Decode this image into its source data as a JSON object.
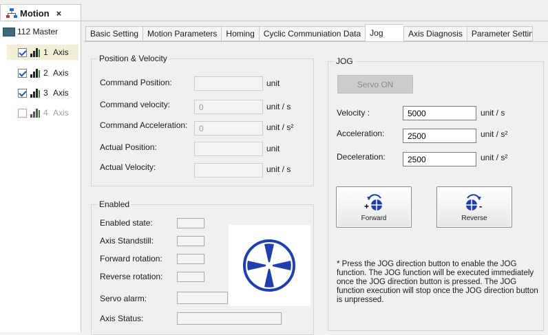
{
  "window": {
    "title": "Motion",
    "close": "×"
  },
  "tree": {
    "master": "112 Master",
    "axes": [
      {
        "num": "1",
        "label": "Axis",
        "checked": true
      },
      {
        "num": "2",
        "label": "Axis",
        "checked": true
      },
      {
        "num": "3",
        "label": "Axis",
        "checked": true
      },
      {
        "num": "4",
        "label": "Axis",
        "checked": false
      }
    ]
  },
  "tabs": [
    "Basic Setting",
    "Motion Parameters",
    "Homing",
    "Cyclic Communiation Data",
    "Jog",
    "Axis Diagnosis",
    "Parameter Settin"
  ],
  "active_tab": "Jog",
  "position_velocity": {
    "legend": "Position & Velocity",
    "rows": [
      {
        "label": "Command Position:",
        "value": "",
        "unit": "unit"
      },
      {
        "label": "Command velocity:",
        "value": "0",
        "unit": "unit / s"
      },
      {
        "label": "Command Acceleration:",
        "value": "0",
        "unit": "unit / s²"
      },
      {
        "label": "Actual Position:",
        "value": "",
        "unit": "unit"
      },
      {
        "label": "Actual Velocity:",
        "value": "",
        "unit": "unit / s"
      }
    ]
  },
  "enabled": {
    "legend": "Enabled",
    "rows": [
      {
        "label": "Enabled state:"
      },
      {
        "label": "Axis Standstill:"
      },
      {
        "label": "Forward rotation:"
      },
      {
        "label": "Reverse rotation:"
      },
      {
        "label": "Servo alarm:"
      },
      {
        "label": "Axis Status:"
      }
    ]
  },
  "jog": {
    "legend": "JOG",
    "servo_button": "Servo ON",
    "velocity": {
      "label": "Velocity :",
      "value": "5000",
      "unit": "unit / s"
    },
    "acceleration": {
      "label": "Acceleration:",
      "value": "2500",
      "unit": "unit / s²"
    },
    "deceleration": {
      "label": "Deceleration:",
      "value": "2500",
      "unit": "unit / s²"
    },
    "forward_label": "Forward",
    "reverse_label": "Reverse",
    "forward_sign": "+",
    "reverse_sign": "-",
    "note": "* Press the JOG direction button to enable the JOG function. The JOG function will be executed immediately once the JOG direction button is pressed. The JOG function execution will stop once the JOG direction button is unpressed."
  },
  "colors": {
    "wheel": "#1f3fae",
    "accent": "#1a56b0"
  }
}
